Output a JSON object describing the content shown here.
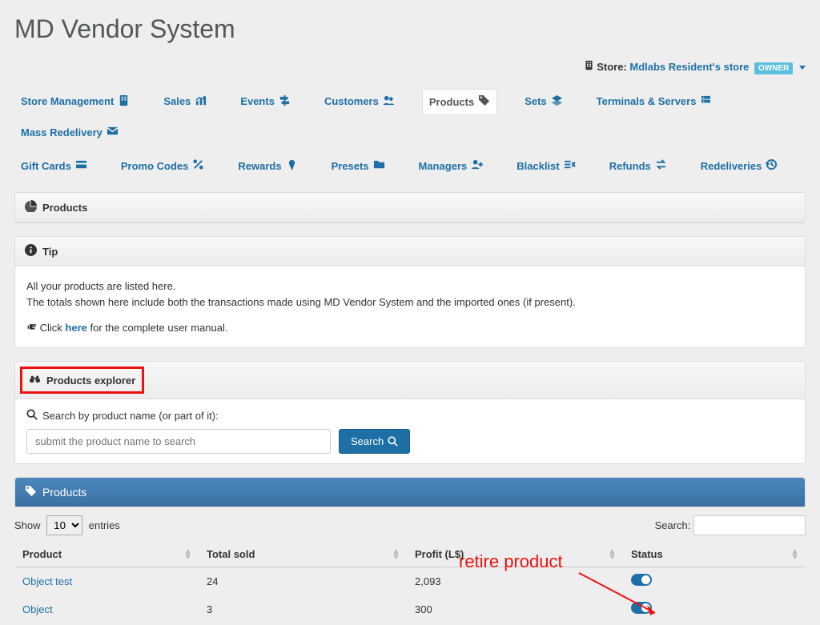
{
  "app": {
    "title": "MD Vendor System"
  },
  "store": {
    "label": "Store:",
    "name": "Mdlabs Resident's store",
    "badge": "OWNER"
  },
  "nav": {
    "row1": [
      {
        "label": "Store Management",
        "icon": "building"
      },
      {
        "label": "Sales",
        "icon": "chart"
      },
      {
        "label": "Events",
        "icon": "signpost"
      },
      {
        "label": "Customers",
        "icon": "users"
      },
      {
        "label": "Products",
        "icon": "tag",
        "active": true
      },
      {
        "label": "Sets",
        "icon": "layers"
      },
      {
        "label": "Terminals & Servers",
        "icon": "server"
      },
      {
        "label": "Mass Redelivery",
        "icon": "mail"
      }
    ],
    "row2": [
      {
        "label": "Gift Cards",
        "icon": "card"
      },
      {
        "label": "Promo Codes",
        "icon": "percent"
      },
      {
        "label": "Rewards",
        "icon": "award"
      },
      {
        "label": "Presets",
        "icon": "folder"
      },
      {
        "label": "Managers",
        "icon": "userplus"
      },
      {
        "label": "Blacklist",
        "icon": "listx"
      },
      {
        "label": "Refunds",
        "icon": "exchange"
      },
      {
        "label": "Redeliveries",
        "icon": "history"
      }
    ]
  },
  "products_header": "Products",
  "tip": {
    "title": "Tip",
    "line1": "All your products are listed here.",
    "line2": "The totals shown here include both the transactions made using MD Vendor System and the imported ones (if present).",
    "click": "Click",
    "here": "here",
    "manual": "for the complete user manual."
  },
  "explorer": {
    "title": "Products explorer",
    "search_label": "Search by product name (or part of it):",
    "placeholder": "submit the product name to search",
    "button": "Search"
  },
  "table": {
    "title": "Products",
    "show": "Show",
    "entries": "entries",
    "page_size": "10",
    "search_label": "Search:",
    "columns": {
      "product": "Product",
      "total_sold": "Total sold",
      "profit": "Profit (L$)",
      "status": "Status"
    },
    "rows": [
      {
        "product": "Object test",
        "total_sold": "24",
        "profit": "2,093",
        "status": "on"
      },
      {
        "product": "Object",
        "total_sold": "3",
        "profit": "300",
        "status": "on"
      }
    ]
  },
  "annotation": {
    "text": "retire product"
  },
  "chart_data": {
    "type": "table",
    "columns": [
      "Product",
      "Total sold",
      "Profit (L$)",
      "Status"
    ],
    "rows": [
      [
        "Object test",
        24,
        2093,
        "on"
      ],
      [
        "Object",
        3,
        300,
        "on"
      ]
    ]
  }
}
